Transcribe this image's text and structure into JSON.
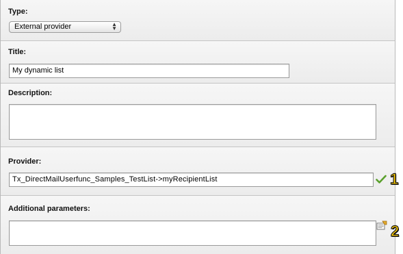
{
  "type": {
    "label": "Type:",
    "value": "External provider"
  },
  "title": {
    "label": "Title:",
    "value": "My dynamic list"
  },
  "description": {
    "label": "Description:",
    "value": ""
  },
  "provider": {
    "label": "Provider:",
    "value": "Tx_DirectMailUserfunc_Samples_TestList->myRecipientList"
  },
  "additional": {
    "label": "Additional parameters:",
    "value": ""
  },
  "callouts": {
    "one": "1",
    "two": "2"
  },
  "icons": {
    "check": "checkmark-icon",
    "wizard": "wizard-icon"
  },
  "colors": {
    "callout_fill": "#ffcc00",
    "check_green": "#5aa02c"
  }
}
